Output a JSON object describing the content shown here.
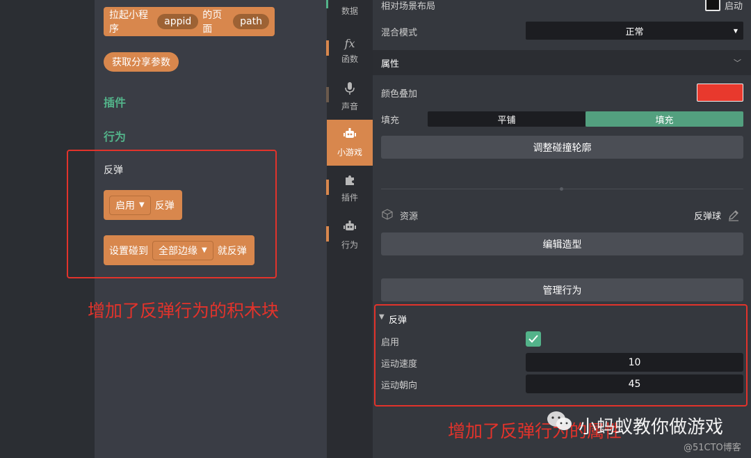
{
  "palette": {
    "block_launch": {
      "prefix": "拉起小程序",
      "slot1": "appid",
      "mid": "的页面",
      "slot2": "path"
    },
    "block_share": "获取分享参数",
    "category_plugins": "插件",
    "category_behavior": "行为",
    "bounce_title": "反弹",
    "block_enable": {
      "dropdown": "启用",
      "suffix": "反弹"
    },
    "block_set_collide": {
      "prefix": "设置碰到",
      "dropdown": "全部边缘",
      "suffix": "就反弹"
    },
    "annotation_left": "增加了反弹行为的积木块"
  },
  "tabs": [
    {
      "label": "数据",
      "icon": "data-icon"
    },
    {
      "label": "函数",
      "icon": "function-icon",
      "glyph": "fx"
    },
    {
      "label": "声音",
      "icon": "microphone-icon"
    },
    {
      "label": "小游戏",
      "icon": "robot-icon",
      "active": true
    },
    {
      "label": "插件",
      "icon": "puzzle-icon"
    },
    {
      "label": "行为",
      "icon": "robot-icon"
    }
  ],
  "properties": {
    "relative_layout_label": "相对场景布局",
    "relative_layout_toggle": "启动",
    "blend_mode_label": "混合模式",
    "blend_mode_value": "正常",
    "attributes_header": "属性",
    "color_overlay_label": "颜色叠加",
    "color_overlay_color": "#e8392d",
    "fill_label": "填充",
    "fill_options": [
      "平铺",
      "填充"
    ],
    "fill_selected": "填充",
    "adjust_collision_button": "调整碰撞轮廓",
    "resource_label": "资源",
    "resource_value": "反弹球",
    "edit_costume_button": "编辑造型",
    "manage_behavior_button": "管理行为",
    "bounce": {
      "header": "反弹",
      "enable_label": "启用",
      "enabled": true,
      "speed_label": "运动速度",
      "speed_value": "10",
      "direction_label": "运动朝向",
      "direction_value": "45"
    },
    "annotation_right": "增加了反弹行为的属性"
  },
  "watermark": {
    "title": "小蚂蚁教你做游戏",
    "source": "@51CTO博客"
  },
  "colors": {
    "accent_orange": "#d8874d",
    "accent_green": "#53b38a",
    "annotation_red": "#e2332b"
  }
}
